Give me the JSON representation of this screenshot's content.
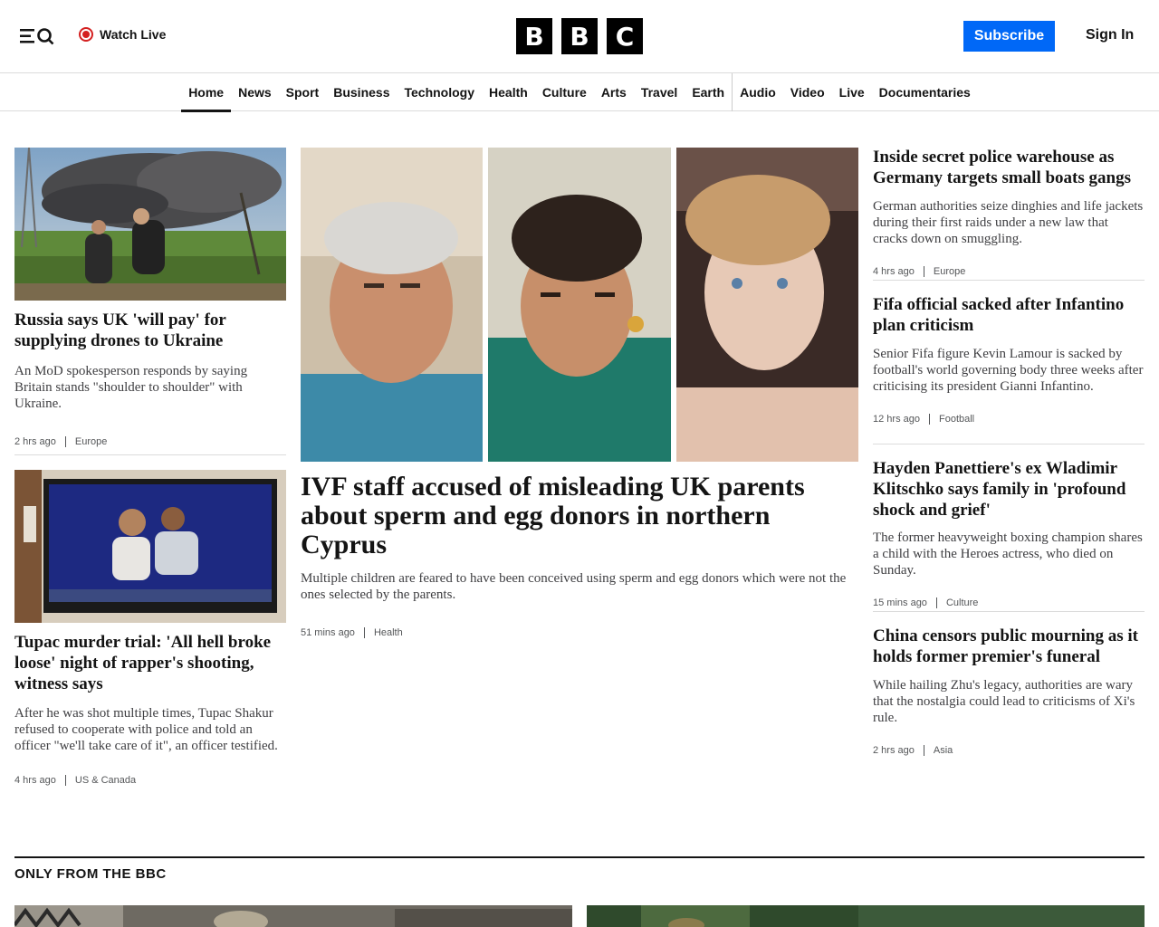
{
  "header": {
    "menu_icon": "menu-icon",
    "search_icon": "search-icon",
    "watch_live_label": "Watch Live",
    "logo_letters": [
      "B",
      "B",
      "C"
    ],
    "subscribe_label": "Subscribe",
    "signin_label": "Sign In",
    "accent_color": "#0068f7",
    "live_color": "#d42020"
  },
  "nav": {
    "items": [
      {
        "label": "Home",
        "active": true
      },
      {
        "label": "News"
      },
      {
        "label": "Sport"
      },
      {
        "label": "Business"
      },
      {
        "label": "Technology"
      },
      {
        "label": "Health"
      },
      {
        "label": "Culture"
      },
      {
        "label": "Arts"
      },
      {
        "label": "Travel"
      },
      {
        "label": "Earth"
      },
      {
        "label": "Audio"
      },
      {
        "label": "Video"
      },
      {
        "label": "Live"
      },
      {
        "label": "Documentaries"
      }
    ]
  },
  "left_column": [
    {
      "headline": "Russia says UK 'will pay' for supplying drones to Ukraine",
      "summary": "An MoD spokesperson responds by saying Britain stands \"shoulder to shoulder\" with Ukraine.",
      "time": "2 hrs ago",
      "tag": "Europe"
    },
    {
      "headline": "Tupac murder trial: 'All hell broke loose' night of rapper's shooting, witness says",
      "summary": "After he was shot multiple times, Tupac Shakur refused to cooperate with police and told an officer \"we'll take care of it\", an officer testified.",
      "time": "4 hrs ago",
      "tag": "US & Canada"
    }
  ],
  "lead_story": {
    "headline": "IVF staff accused of misleading UK parents about sperm and egg donors in northern Cyprus",
    "summary": "Multiple children are feared to have been conceived using sperm and egg donors which were not the ones selected by the parents.",
    "time": "51 mins ago",
    "tag": "Health"
  },
  "right_column": [
    {
      "headline": "Inside secret police warehouse as Germany targets small boats gangs",
      "summary": "German authorities seize dinghies and life jackets during their first raids under a new law that cracks down on smuggling.",
      "time": "4 hrs ago",
      "tag": "Europe"
    },
    {
      "headline": "Fifa official sacked after Infantino plan criticism",
      "summary": "Senior Fifa figure Kevin Lamour is sacked by football's world governing body three weeks after criticising its president Gianni Infantino.",
      "time": "12 hrs ago",
      "tag": "Football"
    },
    {
      "headline": "Hayden Panettiere's ex Wladimir Klitschko says family in 'profound shock and grief'",
      "summary": "The former heavyweight boxing champion shares a child with the Heroes actress, who died on Sunday.",
      "time": "15 mins ago",
      "tag": "Culture"
    },
    {
      "headline": "China censors public mourning as it holds former premier's funeral",
      "summary": "While hailing Zhu's legacy, authorities are wary that the nostalgia could lead to criticisms of Xi's rule.",
      "time": "2 hrs ago",
      "tag": "Asia"
    }
  ],
  "only_from_bbc": {
    "title": "ONLY FROM THE BBC"
  }
}
